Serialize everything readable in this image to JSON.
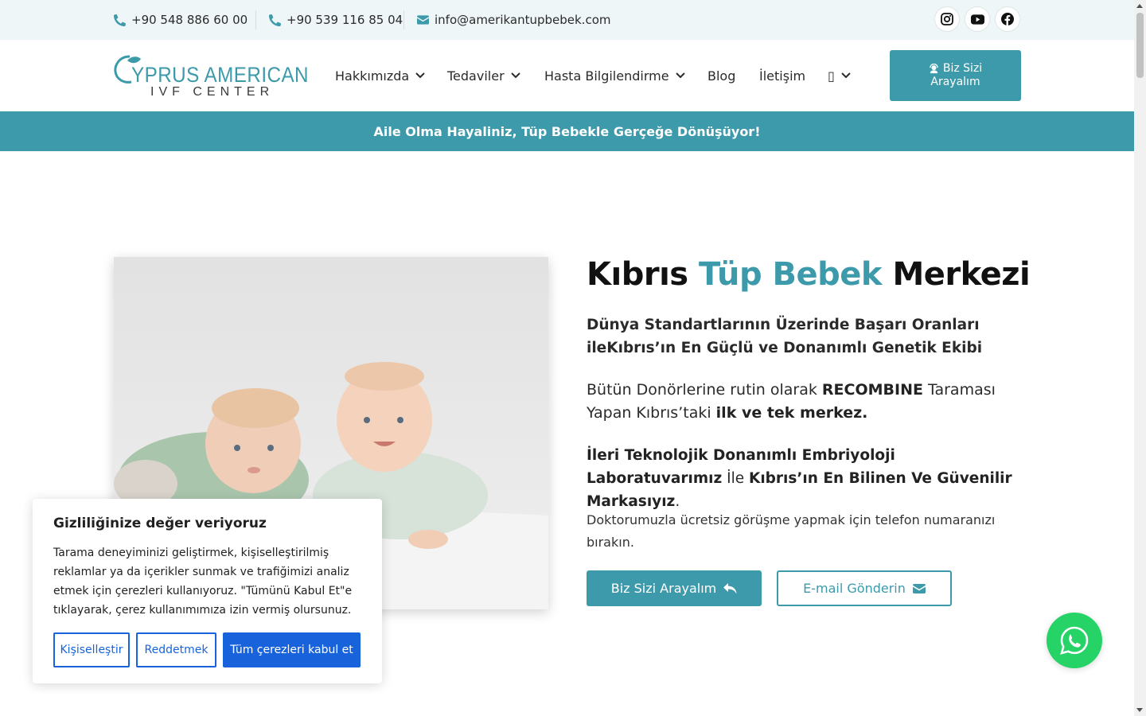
{
  "topbar": {
    "phone1": "+90 548 886 60 00",
    "phone2": "+90 539 116 85 04",
    "email": "info@amerikantupbebek.com",
    "social": [
      "instagram-icon",
      "youtube-icon",
      "facebook-icon"
    ]
  },
  "logo": {
    "line1": "CYPRUS AMERICAN",
    "line2": "IVF CENTER"
  },
  "nav": {
    "items": [
      {
        "label": "Hakkımızda"
      },
      {
        "label": "Tedaviler"
      },
      {
        "label": "Hasta Bilgilendirme"
      },
      {
        "label": "Blog"
      },
      {
        "label": "İletişim"
      },
      {
        "label": "▯"
      }
    ],
    "call_line1": "Biz Sizi",
    "call_line2": "Arayalım"
  },
  "announcement": "Aile Olma Hayaliniz, Tüp Bebekle Gerçeğe Dönüşüyor!",
  "hero": {
    "title_a": "Kıbrıs ",
    "title_b": "Tüp Bebek",
    "title_c": " Merkezi",
    "p1": "Dünya Standartlarının Üzerinde Başarı Oranları ileKıbrıs’ın En Güçlü ve Donanımlı Genetik Ekibi",
    "p2_a": "Bütün Donörlerine rutin olarak ",
    "p2_b": "RECOMBINE",
    "p2_c": " Taraması Yapan Kıbrıs’taki ",
    "p2_d": "ilk ve tek merkez.",
    "p3_a": "İleri Teknolojik Donanımlı Embriyoloji Laboratuvarımız",
    "p3_b": " İle ",
    "p3_c": "Kıbrıs’ın En Bilinen Ve Güvenilir Markasıyız",
    "p3_d": ".",
    "small": "Doktorumuzla ücretsiz görüşme yapmak için telefon numaranızı bırakın.",
    "btn_call": "Biz Sizi Arayalım",
    "btn_email": "E-mail Gönderin"
  },
  "cookie": {
    "title": "Gizliliğinize değer veriyoruz",
    "text": "Tarama deneyiminizi geliştirmek, kişiselleştirilmiş reklamlar ya da içerikler sunmak ve trafiğimizi analiz etmek için çerezleri kullanıyoruz. \"Tümünü Kabul Et\"e tıklayarak, çerez kullanımımıza izin vermiş olursunuz.",
    "btn_customize": "Kişiselleştir",
    "btn_reject": "Reddetmek",
    "btn_accept": "Tüm çerezleri kabul et"
  },
  "colors": {
    "accent": "#3d9aab",
    "topbar_bg": "#eef6f8",
    "cookie_blue": "#1863dc",
    "whatsapp": "#25d366"
  }
}
